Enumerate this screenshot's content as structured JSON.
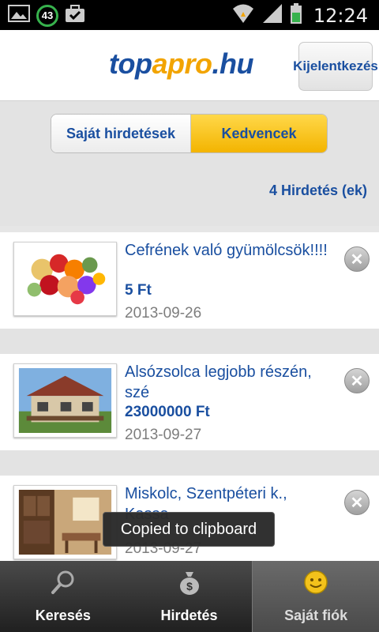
{
  "status_bar": {
    "battery_badge": "43",
    "time": "12:24"
  },
  "header": {
    "logo_part1": "top",
    "logo_part2": "apro",
    "logo_part3": ".hu",
    "logout_label": "Kijelentkezés"
  },
  "segments": {
    "own_ads": "Saját hirdetések",
    "favorites": "Kedvencek",
    "active": "favorites"
  },
  "ad_count": "4 Hirdetés (ek)",
  "items": [
    {
      "title": "Cefrének való gyümölcsök!!!!",
      "price": "5 Ft",
      "date": "2013-09-26",
      "image": "fruit-photo"
    },
    {
      "title": "Alsózsolca legjobb részén, szé",
      "price": "23000000 Ft",
      "date": "2013-09-27",
      "image": "house-photo"
    },
    {
      "title": "Miskolc, Szentpéteri k., Kassa",
      "price": "",
      "date": "2013-09-27",
      "image": "room-photo"
    }
  ],
  "toast": "Copied to clipboard",
  "tabs": [
    {
      "label": "Keresés",
      "icon": "search-icon"
    },
    {
      "label": "Hirdetés",
      "icon": "money-bag-icon"
    },
    {
      "label": "Saját fiók",
      "icon": "smiley-icon",
      "active": true
    }
  ],
  "colors": {
    "brand_blue": "#1a4fa0",
    "brand_yellow": "#f3b400"
  }
}
